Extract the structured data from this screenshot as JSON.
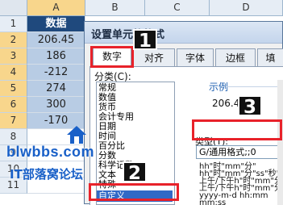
{
  "sheet": {
    "columns": [
      "A",
      "B",
      "C",
      "D"
    ],
    "rows": [
      "1",
      "2",
      "3",
      "4",
      "5",
      "6",
      "7",
      "8",
      "9",
      "10",
      "11"
    ],
    "title_cell": "数据",
    "values": [
      "206.45",
      "186",
      "-212",
      "274",
      "300",
      "-170"
    ]
  },
  "dialog": {
    "title": "设置单元格格式",
    "tabs": [
      "数字",
      "对齐",
      "字体",
      "边框",
      "填"
    ],
    "category_label": "分类(C):",
    "categories": [
      "常规",
      "数值",
      "货币",
      "会计专用",
      "日期",
      "时间",
      "百分比",
      "分数",
      "科学记数",
      "文本",
      "特殊",
      "自定义"
    ],
    "selected_category": "自定义",
    "sample_label": "示例",
    "sample_value": "206.45",
    "type_label": "类型(T):",
    "type_value": "G/通用格式;;0",
    "format_list": [
      "hh\"时\"mm\"分\"",
      "hh\"时\"mm\"分\"ss\"秒\"",
      "上午/下午h\"时\"mm\"分\"",
      "上午/下午h\"时\"mm\"分\"",
      "yyyy-m-d hh:mm",
      "mm:ss"
    ]
  },
  "annotations": {
    "badges": [
      "1",
      "2",
      "3"
    ],
    "watermark_url": "blwbbs.com",
    "watermark_cn": "IT部落窝论坛"
  },
  "colors": {
    "accent_red": "#e8222a",
    "title_cell_bg": "#1f497d",
    "value_cell_bg": "#b8cce4",
    "selection_blue": "#3169c6",
    "watermark_blue": "#1960c8"
  }
}
